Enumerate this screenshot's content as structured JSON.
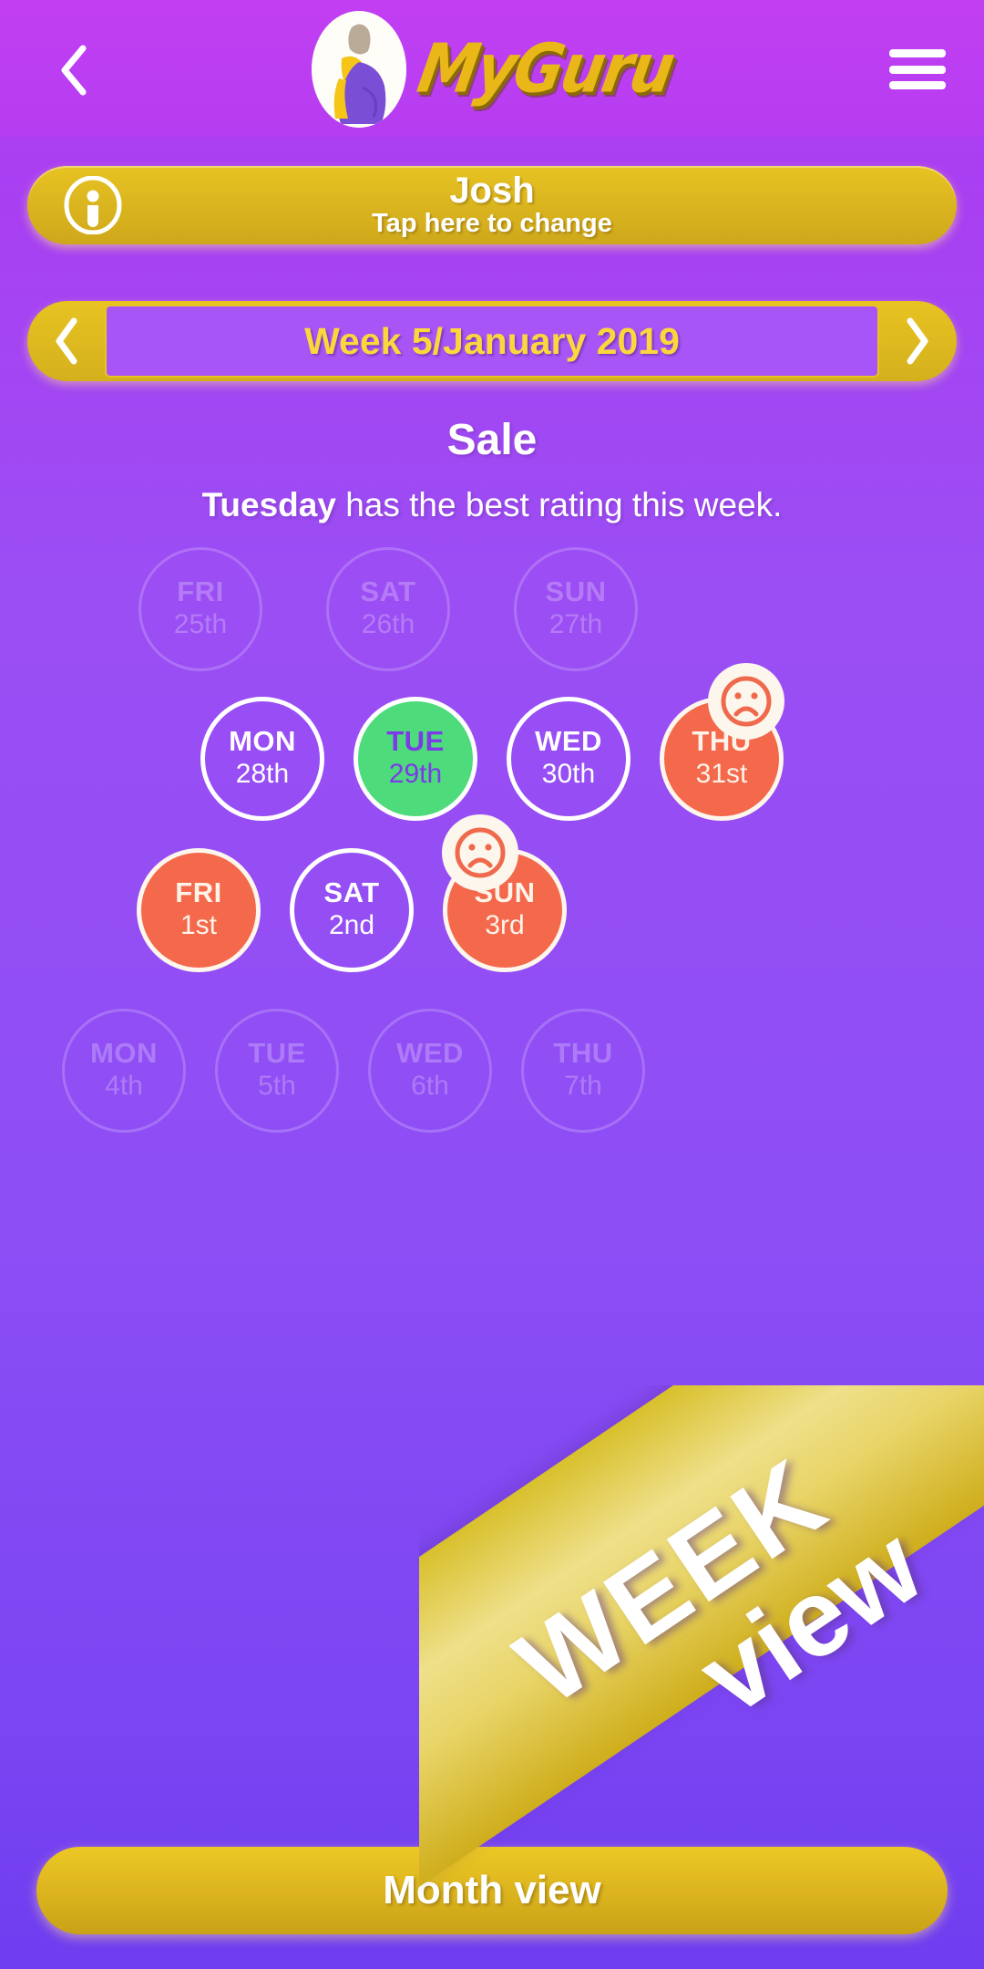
{
  "header": {
    "back_icon": "chevron-left-icon",
    "menu_icon": "hamburger-menu-icon",
    "avatar_icon": "guru-avatar-icon",
    "logo_text": "MyGuru",
    "logo_color": "#e9b818"
  },
  "user_bar": {
    "icon": "user-circle-icon",
    "name": "Josh",
    "subtitle": "Tap here to change"
  },
  "week_nav": {
    "prev_icon": "chevron-left-icon",
    "next_icon": "chevron-right-icon",
    "label": "Week 5/January 2019",
    "label_color": "#fbd63d"
  },
  "headline": {
    "title": "Sale",
    "subtitle_bold": "Tuesday",
    "subtitle_rest": " has the best rating this week."
  },
  "colors": {
    "background_purple": "#9b4ef4",
    "gold": "#e8c322",
    "good_green": "#4ddb7b",
    "bad_coral": "#f4684c",
    "white": "#ffffff"
  },
  "calendar": {
    "rows": [
      {
        "id": "dim-top",
        "days": [
          {
            "dow": "FRI",
            "dom": "25th",
            "state": "dim",
            "badge": null
          },
          {
            "dow": "SAT",
            "dom": "26th",
            "state": "dim",
            "badge": null
          },
          {
            "dow": "SUN",
            "dom": "27th",
            "state": "dim",
            "badge": null
          }
        ]
      },
      {
        "id": "active-1",
        "days": [
          {
            "dow": "MON",
            "dom": "28th",
            "state": "plain",
            "badge": null
          },
          {
            "dow": "TUE",
            "dom": "29th",
            "state": "good",
            "badge": null
          },
          {
            "dow": "WED",
            "dom": "30th",
            "state": "plain",
            "badge": null
          },
          {
            "dow": "THU",
            "dom": "31st",
            "state": "bad",
            "badge": "sad-face-icon"
          }
        ]
      },
      {
        "id": "active-2",
        "days": [
          {
            "dow": "FRI",
            "dom": "1st",
            "state": "bad",
            "badge": null
          },
          {
            "dow": "SAT",
            "dom": "2nd",
            "state": "plain",
            "badge": null
          },
          {
            "dow": "SUN",
            "dom": "3rd",
            "state": "bad",
            "badge": "sad-face-icon"
          }
        ]
      },
      {
        "id": "dim-bottom",
        "days": [
          {
            "dow": "MON",
            "dom": "4th",
            "state": "dim",
            "badge": null
          },
          {
            "dow": "TUE",
            "dom": "5th",
            "state": "dim",
            "badge": null
          },
          {
            "dow": "WED",
            "dom": "6th",
            "state": "dim",
            "badge": null
          },
          {
            "dow": "THU",
            "dom": "7th",
            "state": "dim",
            "badge": null
          }
        ]
      }
    ]
  },
  "month_button": {
    "label": "Month view"
  },
  "ribbon": {
    "line1": "WEEK",
    "line2": "view"
  }
}
